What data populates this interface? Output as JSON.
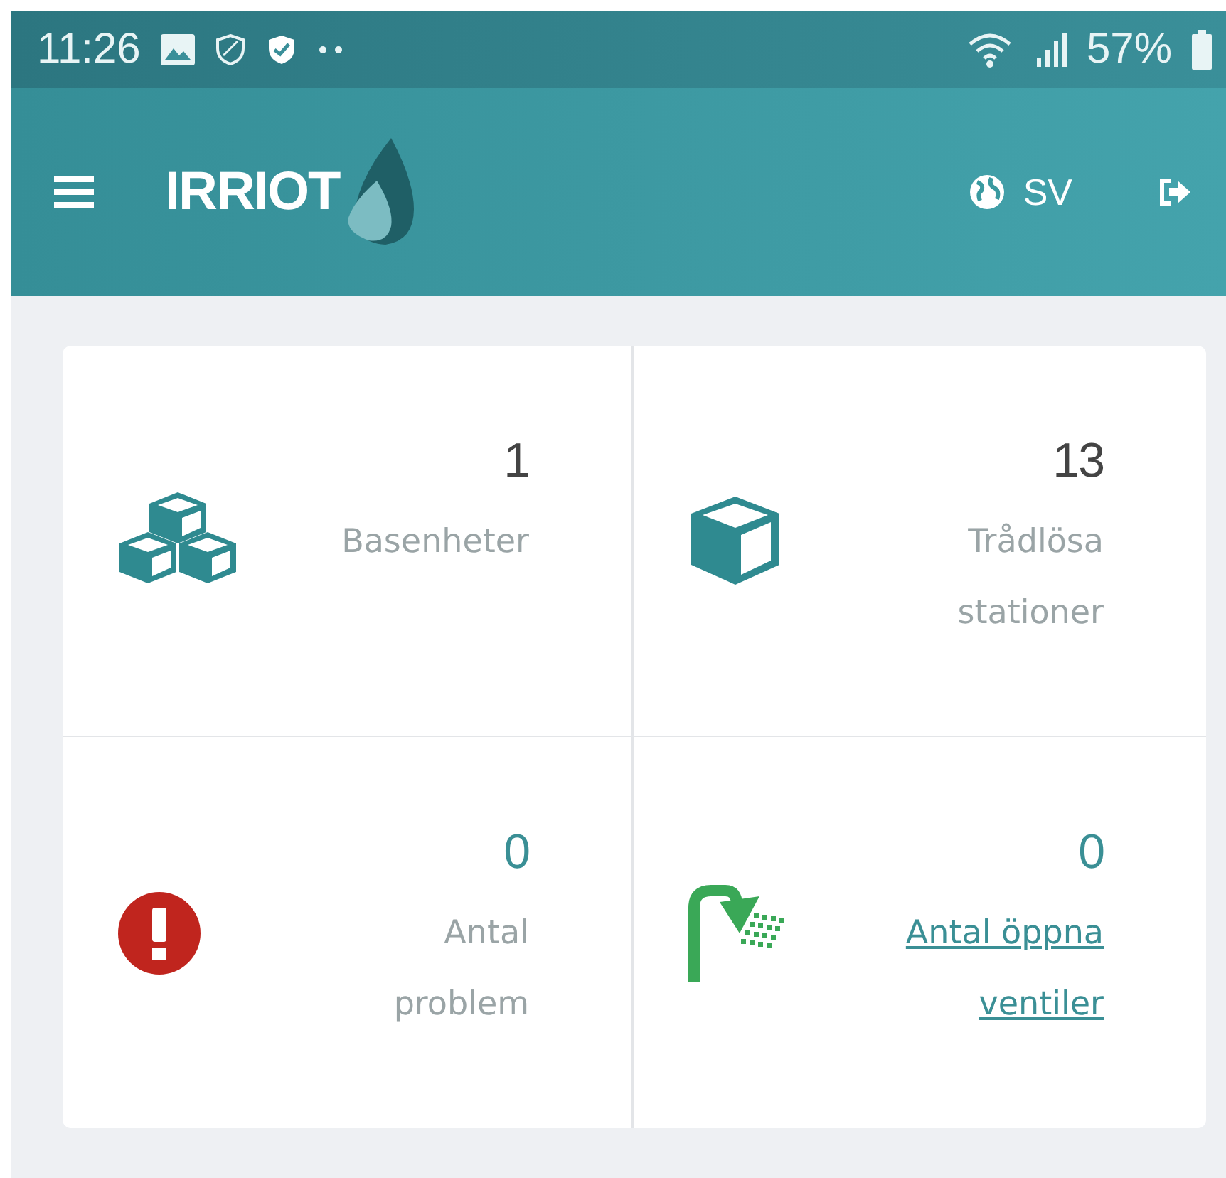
{
  "status_bar": {
    "time": "11:26",
    "battery": "57%"
  },
  "app_bar": {
    "logo": "IRRIOT",
    "language": "SV"
  },
  "tiles": [
    {
      "kind": "cubes",
      "value": "1",
      "color": "#444444",
      "label": "Basenheter",
      "link": false
    },
    {
      "kind": "cube",
      "value": "13",
      "color": "#444444",
      "label": "Trådlösa stationer",
      "link": false
    },
    {
      "kind": "alert",
      "value": "0",
      "color": "#3a8f95",
      "label": "Antal problem",
      "link": false
    },
    {
      "kind": "shower",
      "value": "0",
      "color": "#3a8f95",
      "label": "Antal öppna ventiler",
      "link": true
    }
  ]
}
